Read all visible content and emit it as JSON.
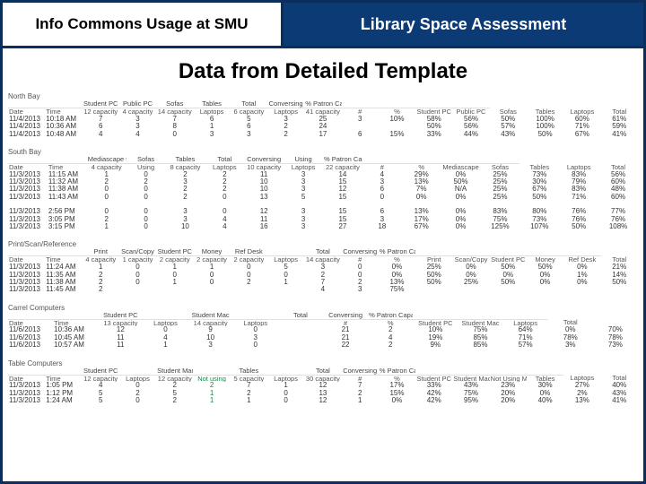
{
  "header": {
    "left": "Info Commons Usage at SMU",
    "right": "Library Space Assessment"
  },
  "title": "Data from Detailed Template",
  "sections": [
    {
      "id": "north-bay",
      "label": "North Bay",
      "group_row": [
        "",
        "",
        "Student PC",
        "Public PC",
        "Sofas",
        "Tables",
        "Total",
        "Conversing",
        "% Patron Capacity",
        "",
        "",
        "",
        ""
      ],
      "header_row": [
        "Date",
        "Time",
        "12 capacity",
        "4 capacity",
        "14 capacity",
        "Laptops",
        "6 capacity",
        "Laptops",
        "41 capacity",
        "#",
        "%",
        "Student PC",
        "Public PC",
        "Sofas",
        "Tables",
        "Laptops",
        "Total"
      ],
      "col_classes": [
        "",
        "",
        "",
        "",
        "",
        "red",
        "",
        "red",
        "",
        "",
        "",
        "",
        "",
        "",
        "",
        "red",
        ""
      ],
      "rows": [
        [
          "11/4/2013",
          "10:18 AM",
          "7",
          "3",
          "7",
          "6",
          "5",
          "3",
          "25",
          "3",
          "10%",
          "58%",
          "56%",
          "50%",
          "100%",
          "60%",
          "61%"
        ],
        [
          "11/4/2013",
          "10:36 AM",
          "6",
          "3",
          "8",
          "1",
          "6",
          "2",
          "24",
          "",
          "",
          "50%",
          "56%",
          "57%",
          "100%",
          "71%",
          "59%"
        ],
        [
          "11/4/2013",
          "10:48 AM",
          "4",
          "4",
          "0",
          "3",
          "3",
          "2",
          "17",
          "6",
          "15%",
          "33%",
          "44%",
          "43%",
          "50%",
          "67%",
          "41%"
        ]
      ]
    },
    {
      "id": "south-bay",
      "label": "South Bay",
      "group_row": [
        "",
        "",
        "Mediascape table",
        "Sofas",
        "Tables",
        "Total",
        "Conversing",
        "Using",
        "% Patron Capacity",
        "",
        "",
        "",
        ""
      ],
      "header_row": [
        "Date",
        "Time",
        "4 capacity",
        "Using",
        "8 capacity",
        "Laptops",
        "10 capacity",
        "Laptops",
        "22 capacity",
        "#",
        "%",
        "Mediascape",
        "Sofas",
        "Tables",
        "Laptops",
        "Total"
      ],
      "col_classes": [
        "",
        "",
        "",
        "",
        "",
        "red",
        "",
        "red",
        "",
        "",
        "",
        "",
        "",
        "",
        "red",
        ""
      ],
      "rows": [
        [
          "11/3/2013",
          "11:15 AM",
          "1",
          "0",
          "2",
          "2",
          "11",
          "3",
          "14",
          "4",
          "29%",
          "0%",
          "25%",
          "73%",
          "83%",
          "56%"
        ],
        [
          "11/3/2013",
          "11:32 AM",
          "2",
          "2",
          "3",
          "2",
          "10",
          "3",
          "15",
          "3",
          "13%",
          "50%",
          "25%",
          "30%",
          "79%",
          "60%"
        ],
        [
          "11/3/2013",
          "11:38 AM",
          "0",
          "0",
          "2",
          "2",
          "10",
          "3",
          "12",
          "6",
          "7%",
          "N/A",
          "25%",
          "67%",
          "83%",
          "48%"
        ],
        [
          "11/3/2013",
          "11:43 AM",
          "0",
          "0",
          "2",
          "0",
          "13",
          "5",
          "15",
          "0",
          "0%",
          "0%",
          "25%",
          "50%",
          "71%",
          "60%"
        ]
      ]
    },
    {
      "id": "south-bay-2",
      "label": "",
      "rows": [
        [
          "11/3/2013",
          "2:56 PM",
          "0",
          "0",
          "3",
          "0",
          "12",
          "3",
          "15",
          "6",
          "13%",
          "0%",
          "83%",
          "80%",
          "76%",
          "77%"
        ],
        [
          "11/3/2013",
          "3:05 PM",
          "2",
          "0",
          "3",
          "4",
          "11",
          "3",
          "15",
          "3",
          "17%",
          "0%",
          "75%",
          "73%",
          "76%",
          "76%"
        ],
        [
          "11/3/2013",
          "3:15 PM",
          "1",
          "0",
          "10",
          "4",
          "16",
          "3",
          "27",
          "18",
          "67%",
          "0%",
          "125%",
          "107%",
          "50%",
          "108%"
        ]
      ]
    },
    {
      "id": "print-scan",
      "label": "Print/Scan/Reference",
      "group_row": [
        "",
        "",
        "Print",
        "Scan/Copy",
        "Student PC",
        "Money",
        "Ref Desk",
        "",
        "Total",
        "Conversing",
        "% Patron Capacity",
        "",
        "",
        "",
        "",
        ""
      ],
      "header_row": [
        "Date",
        "Time",
        "4 capacity",
        "1 capacity",
        "2 capacity",
        "2 capacity",
        "2 capacity",
        "Laptops",
        "14 capacity",
        "#",
        "%",
        "Print",
        "Scan/Copy",
        "Student PC",
        "Money",
        "Ref Desk",
        "Total"
      ],
      "col_classes": [
        "",
        "",
        "",
        "",
        "",
        "",
        "",
        "red",
        "",
        "",
        "",
        "",
        "",
        "",
        "",
        "",
        ""
      ],
      "rows": [
        [
          "11/3/2013",
          "11:24 AM",
          "1",
          "0",
          "1",
          "1",
          "0",
          "5",
          "3",
          "0",
          "0%",
          "25%",
          "0%",
          "50%",
          "50%",
          "0%",
          "21%"
        ],
        [
          "11/3/2013",
          "11:35 AM",
          "2",
          "0",
          "0",
          "0",
          "0",
          "0",
          "2",
          "0",
          "0%",
          "50%",
          "0%",
          "0%",
          "0%",
          "1%",
          "14%"
        ],
        [
          "11/3/2013",
          "11:38 AM",
          "2",
          "0",
          "1",
          "0",
          "2",
          "1",
          "7",
          "2",
          "13%",
          "50%",
          "25%",
          "50%",
          "0%",
          "0%",
          "50%"
        ],
        [
          "11/3/2013",
          "11:45 AM",
          "2",
          "",
          "",
          "",
          "",
          "",
          "4",
          "3",
          "75%",
          "",
          "",
          "",
          "",
          "",
          ""
        ]
      ]
    },
    {
      "id": "carrel",
      "label": "Carrel Computers",
      "group_row": [
        "",
        "",
        "Student PC",
        "",
        "Student Mac",
        "",
        "Total",
        "Conversing",
        "% Patron Capacity",
        "",
        "",
        ""
      ],
      "header_row": [
        "Date",
        "Time",
        "13 capacity",
        "Laptops",
        "14 capacity",
        "Laptops",
        "",
        "#",
        "%",
        "Student PC",
        "Student Mac",
        "Laptops",
        "Total"
      ],
      "col_classes": [
        "",
        "",
        "",
        "red",
        "",
        "red",
        "",
        "",
        "",
        "",
        "",
        "red",
        ""
      ],
      "rows": [
        [
          "11/6/2013",
          "10:36 AM",
          "12",
          "0",
          "9",
          "0",
          "",
          "21",
          "2",
          "10%",
          "75%",
          "64%",
          "0%",
          "70%"
        ],
        [
          "11/6/2013",
          "10:45 AM",
          "11",
          "4",
          "10",
          "3",
          "",
          "21",
          "4",
          "19%",
          "85%",
          "71%",
          "78%",
          "78%"
        ],
        [
          "11/6/2013",
          "10:57 AM",
          "11",
          "1",
          "3",
          "0",
          "",
          "22",
          "2",
          "9%",
          "85%",
          "57%",
          "3%",
          "73%"
        ]
      ]
    },
    {
      "id": "table-computers",
      "label": "Table Computers",
      "group_row": [
        "",
        "",
        "Student PC",
        "",
        "Student Mac",
        "",
        "Tables",
        "",
        "Total",
        "Conversing",
        "% Patron Capacity",
        "",
        "",
        "",
        ""
      ],
      "header_row": [
        "Date",
        "Time",
        "12 capacity",
        "Laptops",
        "12 capacity",
        "Not using",
        "5 capacity",
        "Laptops",
        "30 capacity",
        "#",
        "%",
        "Student PC",
        "Student Mac",
        "Not Using Mac",
        "Tables",
        "Laptops",
        "Total"
      ],
      "col_classes": [
        "",
        "",
        "",
        "red",
        "",
        "green",
        "",
        "red",
        "",
        "",
        "",
        "",
        "",
        "",
        "",
        "red",
        ""
      ],
      "rows": [
        [
          "11/3/2013",
          "1:05 PM",
          "4",
          "0",
          "2",
          "2",
          "7",
          "1",
          "12",
          "7",
          "17%",
          "33%",
          "43%",
          "23%",
          "30%",
          "27%",
          "40%"
        ],
        [
          "11/3/2013",
          "1:12 PM",
          "5",
          "2",
          "5",
          "1",
          "2",
          "0",
          "13",
          "2",
          "15%",
          "42%",
          "75%",
          "20%",
          "0%",
          "2%",
          "43%"
        ],
        [
          "11/3/2013",
          "1:24 AM",
          "5",
          "0",
          "2",
          "1",
          "1",
          "0",
          "12",
          "1",
          "0%",
          "42%",
          "95%",
          "20%",
          "40%",
          "13%",
          "41%"
        ]
      ]
    }
  ]
}
